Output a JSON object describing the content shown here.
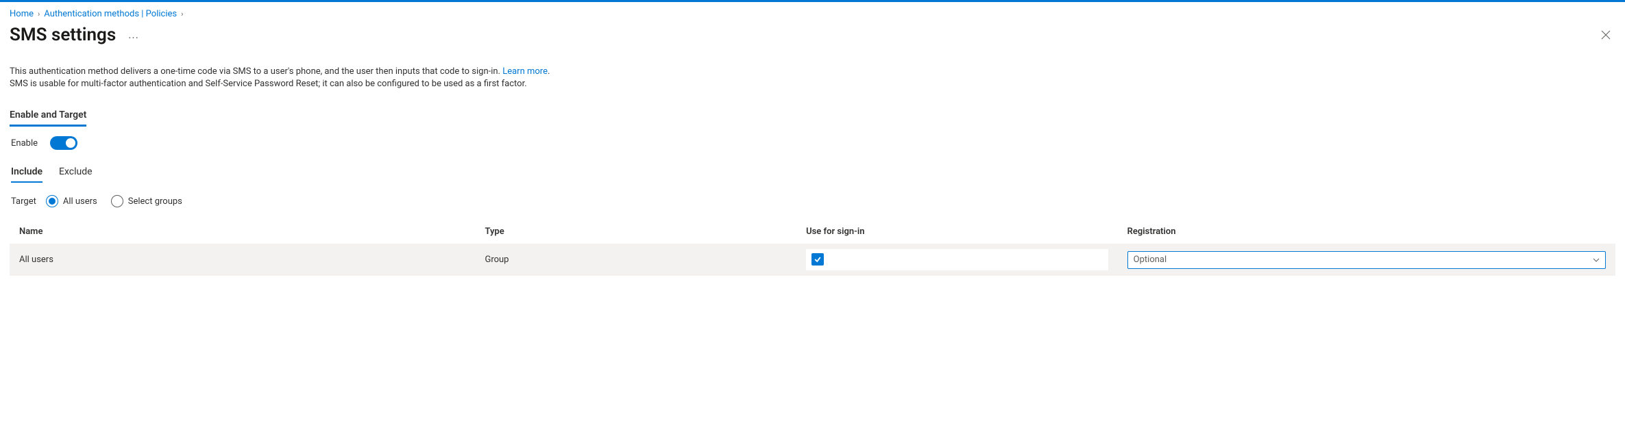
{
  "breadcrumb": {
    "home": "Home",
    "auth": "Authentication methods | Policies"
  },
  "title": "SMS settings",
  "description": {
    "line1_a": "This authentication method delivers a one-time code via SMS to a user's phone, and the user then inputs that code to sign-in. ",
    "learn_more": "Learn more",
    "period": ".",
    "line2": "SMS is usable for multi-factor authentication and Self-Service Password Reset; it can also be configured to be used as a first factor."
  },
  "mainTab": "Enable and Target",
  "enable": {
    "label": "Enable",
    "value": true
  },
  "subTabs": {
    "include": "Include",
    "exclude": "Exclude"
  },
  "target": {
    "label": "Target",
    "allUsers": "All users",
    "selectGroups": "Select groups"
  },
  "table": {
    "headers": {
      "name": "Name",
      "type": "Type",
      "signin": "Use for sign-in",
      "registration": "Registration"
    },
    "row": {
      "name": "All users",
      "type": "Group",
      "signin_checked": true,
      "registration": "Optional"
    }
  }
}
